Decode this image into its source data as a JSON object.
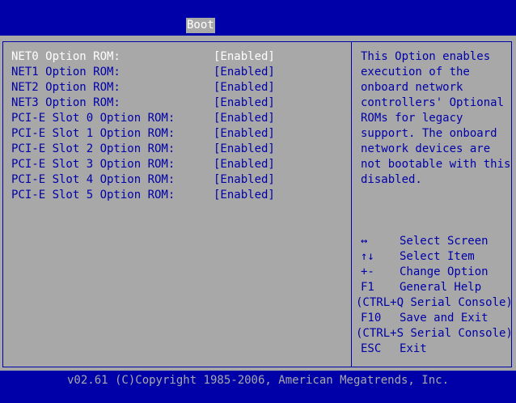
{
  "header": {
    "active_tab": "Boot"
  },
  "options": [
    {
      "label": "NET0 Option ROM:",
      "value": "[Enabled]",
      "selected": true
    },
    {
      "label": "NET1 Option ROM:",
      "value": "[Enabled]"
    },
    {
      "label": "NET2 Option ROM:",
      "value": "[Enabled]"
    },
    {
      "label": "NET3 Option ROM:",
      "value": "[Enabled]"
    },
    {
      "label": "PCI-E Slot 0 Option ROM:",
      "value": "[Enabled]"
    },
    {
      "label": "PCI-E Slot 1 Option ROM:",
      "value": "[Enabled]"
    },
    {
      "label": "PCI-E Slot 2 Option ROM:",
      "value": "[Enabled]"
    },
    {
      "label": "PCI-E Slot 3 Option ROM:",
      "value": "[Enabled]"
    },
    {
      "label": "PCI-E Slot 4 Option ROM:",
      "value": "[Enabled]"
    },
    {
      "label": "PCI-E Slot 5 Option ROM:",
      "value": "[Enabled]"
    }
  ],
  "help": {
    "lines": [
      "This Option enables",
      "execution of the",
      "onboard network",
      "controllers' Optional",
      "ROMs for legacy",
      "support. The onboard",
      "network devices are",
      "not bootable with this",
      "disabled."
    ]
  },
  "keys": [
    {
      "key": "↔",
      "desc": "Select Screen"
    },
    {
      "key": "↑↓",
      "desc": "Select Item"
    },
    {
      "key": "+-",
      "desc": "Change Option"
    },
    {
      "key": "F1",
      "desc": "General Help"
    },
    {
      "full": "(CTRL+Q Serial Console)"
    },
    {
      "key": "F10",
      "desc": "Save and Exit"
    },
    {
      "full": "(CTRL+S Serial Console)"
    },
    {
      "key": "ESC",
      "desc": "Exit"
    }
  ],
  "footer": {
    "text": "v02.61 (C)Copyright 1985-2006, American Megatrends, Inc."
  },
  "colors": {
    "background": "#0000a8",
    "panel": "#a8a8a8",
    "highlight_text": "#ffffff"
  }
}
